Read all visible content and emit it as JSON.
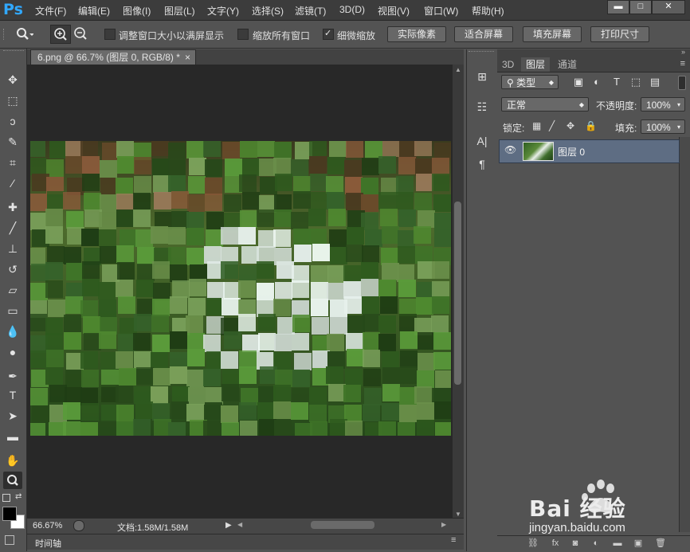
{
  "app": {
    "logo": "Ps"
  },
  "menu": [
    "文件(F)",
    "编辑(E)",
    "图像(I)",
    "图层(L)",
    "文字(Y)",
    "选择(S)",
    "滤镜(T)",
    "3D(D)",
    "视图(V)",
    "窗口(W)",
    "帮助(H)"
  ],
  "window_controls": {
    "minimize": "▬",
    "maximize": "□",
    "close": "✕"
  },
  "options": {
    "resize_windows": {
      "label": "调整窗口大小以满屏显示",
      "checked": false
    },
    "zoom_all": {
      "label": "缩放所有窗口",
      "checked": false
    },
    "scrubby_zoom": {
      "label": "细微缩放",
      "checked": true
    },
    "buttons": [
      "实际像素",
      "适合屏幕",
      "填充屏幕",
      "打印尺寸"
    ]
  },
  "document": {
    "tab_title": "6.png @ 66.7% (图层 0, RGB/8) *",
    "tab_close": "×",
    "zoom": "66.67%",
    "doc_size": "文档:1.58M/1.58M",
    "timeline": "时间轴"
  },
  "layers_panel": {
    "tabs": [
      "3D",
      "图层",
      "通道"
    ],
    "active_tab": "图层",
    "filter_kind": "类型",
    "blend_mode": "正常",
    "opacity_label": "不透明度:",
    "opacity_value": "100%",
    "lock_label": "锁定:",
    "fill_label": "填充:",
    "fill_value": "100%",
    "layers": [
      {
        "name": "图层 0",
        "visible": true
      }
    ]
  },
  "watermark": {
    "brand": "Bai 经验",
    "url": "jingyan.baidu.com"
  },
  "colors": {
    "foreground": "#000000",
    "background": "#ffffff",
    "accent": "#31a8ff",
    "selected_layer": "#5e6d83"
  }
}
